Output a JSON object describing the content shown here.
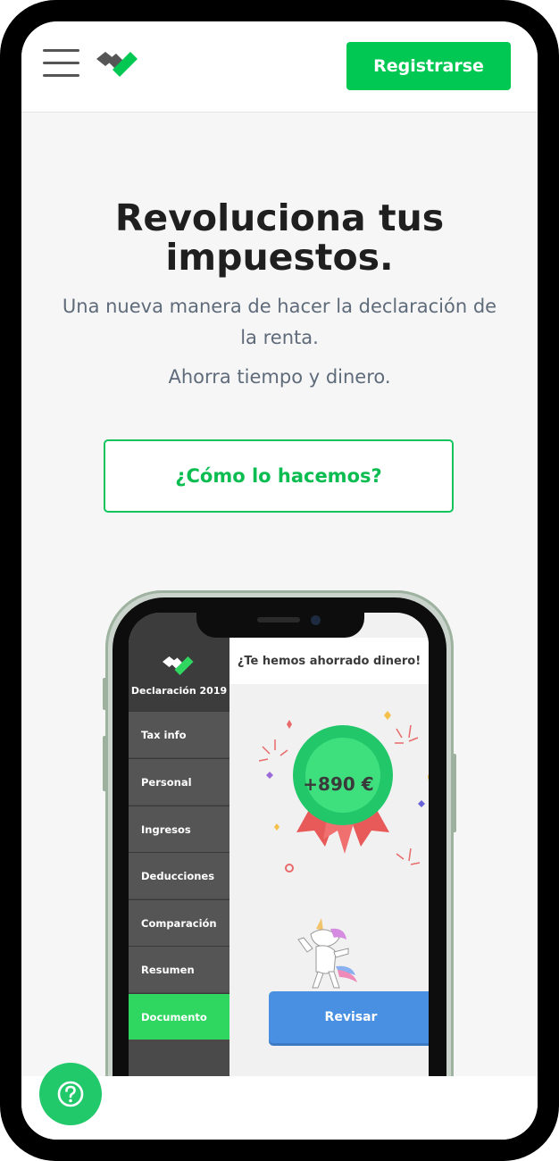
{
  "header": {
    "register_label": "Registrarse",
    "icons": {
      "menu": "hamburger-menu-icon",
      "logo": "check-logo-icon"
    }
  },
  "hero": {
    "title": "Revoluciona tus impuestos.",
    "subtitle": "Una nueva manera de hacer la declaración de la renta.",
    "tagline": "Ahorra tiempo y dinero.",
    "cta_label": "¿Cómo lo hacemos?"
  },
  "mockup": {
    "sidebar_title": "Declaración 2019",
    "sidebar_items": [
      {
        "label": "Tax info"
      },
      {
        "label": "Personal"
      },
      {
        "label": "Ingresos"
      },
      {
        "label": "Deducciones"
      },
      {
        "label": "Comparación"
      },
      {
        "label": "Resumen"
      },
      {
        "label": "Documento"
      }
    ],
    "active_item": "Documento",
    "panel_title": "¿Te hemos ahorrado dinero!",
    "savings": "+890 €",
    "review_label": "Revisar"
  },
  "colors": {
    "brand_green": "#00c853",
    "accent_blue": "#4a90e2",
    "sidebar_gray": "#4a4a4a"
  },
  "help": {
    "icon": "help-question-icon"
  }
}
